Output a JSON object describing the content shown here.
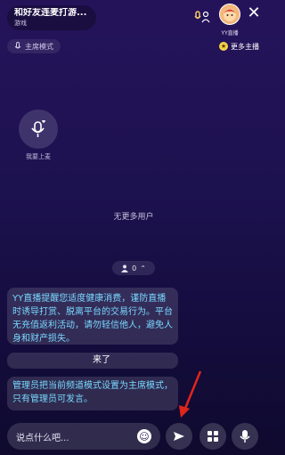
{
  "room": {
    "title": "和好友连麦打游...",
    "category": "游戏"
  },
  "host": {
    "label": "YY直播",
    "more_label": "更多主播"
  },
  "mode": {
    "label": "主席模式"
  },
  "seat": {
    "label": "我要上麦"
  },
  "empty_state": {
    "text": "无更多用户"
  },
  "online": {
    "count": "0"
  },
  "messages": {
    "warning": "YY直播提醒您适度健康消费，谨防直播时诱导打赏、脱离平台的交易行为。平台无充值返利活动，请勿轻信他人，避免人身和财产损失。",
    "user_text": "来了",
    "admin": "管理员把当前频道模式设置为主席模式，只有管理员可发言。"
  },
  "input": {
    "placeholder": "说点什么吧..."
  },
  "colors": {
    "notice_text": "#79d9ff",
    "annotation_arrow": "#e0261b"
  },
  "icons": [
    "mic-ring-icon",
    "close-icon",
    "mic-icon",
    "chevron-up-icon",
    "emoji-icon",
    "share-icon",
    "grid-icon"
  ]
}
